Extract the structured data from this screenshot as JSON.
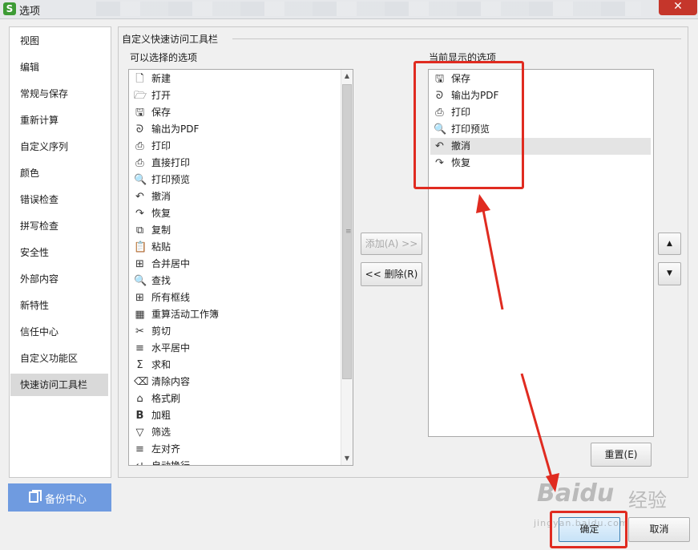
{
  "window": {
    "title": "选项",
    "app_icon_letter": "S",
    "close_glyph": "✕"
  },
  "sidebar": {
    "items": [
      {
        "label": "视图"
      },
      {
        "label": "编辑"
      },
      {
        "label": "常规与保存"
      },
      {
        "label": "重新计算"
      },
      {
        "label": "自定义序列"
      },
      {
        "label": "颜色"
      },
      {
        "label": "错误检查"
      },
      {
        "label": "拼写检查"
      },
      {
        "label": "安全性"
      },
      {
        "label": "外部内容"
      },
      {
        "label": "新特性"
      },
      {
        "label": "信任中心"
      },
      {
        "label": "自定义功能区"
      },
      {
        "label": "快速访问工具栏",
        "selected": true
      }
    ],
    "backup_label": "备份中心"
  },
  "main": {
    "group_title": "自定义快速访问工具栏",
    "available_label": "可以选择的选项",
    "current_label": "当前显示的选项",
    "available_items": [
      {
        "label": "新建",
        "icon": "new-file-icon"
      },
      {
        "label": "打开",
        "icon": "open-folder-icon"
      },
      {
        "label": "保存",
        "icon": "save-icon"
      },
      {
        "label": "输出为PDF",
        "icon": "pdf-icon"
      },
      {
        "label": "打印",
        "icon": "print-icon"
      },
      {
        "label": "直接打印",
        "icon": "direct-print-icon"
      },
      {
        "label": "打印预览",
        "icon": "print-preview-icon"
      },
      {
        "label": "撤消",
        "icon": "undo-icon"
      },
      {
        "label": "恢复",
        "icon": "redo-icon"
      },
      {
        "label": "复制",
        "icon": "copy-icon"
      },
      {
        "label": "粘贴",
        "icon": "paste-icon"
      },
      {
        "label": "合并居中",
        "icon": "merge-center-icon"
      },
      {
        "label": "查找",
        "icon": "find-icon"
      },
      {
        "label": "所有框线",
        "icon": "all-borders-icon"
      },
      {
        "label": "重算活动工作簿",
        "icon": "recalc-icon"
      },
      {
        "label": "剪切",
        "icon": "cut-icon"
      },
      {
        "label": "水平居中",
        "icon": "align-center-icon"
      },
      {
        "label": "求和",
        "icon": "sum-icon"
      },
      {
        "label": "清除内容",
        "icon": "clear-icon"
      },
      {
        "label": "格式刷",
        "icon": "format-painter-icon"
      },
      {
        "label": "加粗",
        "icon": "bold-icon"
      },
      {
        "label": "筛选",
        "icon": "filter-icon"
      },
      {
        "label": "左对齐",
        "icon": "align-left-icon"
      },
      {
        "label": "自动换行",
        "icon": "wrap-icon"
      }
    ],
    "current_items": [
      {
        "label": "保存",
        "icon": "save-icon"
      },
      {
        "label": "输出为PDF",
        "icon": "pdf-icon"
      },
      {
        "label": "打印",
        "icon": "print-icon"
      },
      {
        "label": "打印预览",
        "icon": "print-preview-icon"
      },
      {
        "label": "撤消",
        "icon": "undo-icon",
        "selected": true
      },
      {
        "label": "恢复",
        "icon": "redo-icon"
      }
    ],
    "add_button": "添加(A) >>",
    "remove_button": "<< 删除(R)",
    "reset_button": "重置(E)",
    "move_up_glyph": "▲",
    "move_down_glyph": "▼"
  },
  "footer": {
    "ok_button": "确定",
    "cancel_button": "取消"
  },
  "watermark": {
    "brand": "Baidu",
    "brand_cn": "经验",
    "url": "jingyan.baidu.com"
  },
  "annotation_color": "#e02b20",
  "accent_color": "#6f9be0"
}
